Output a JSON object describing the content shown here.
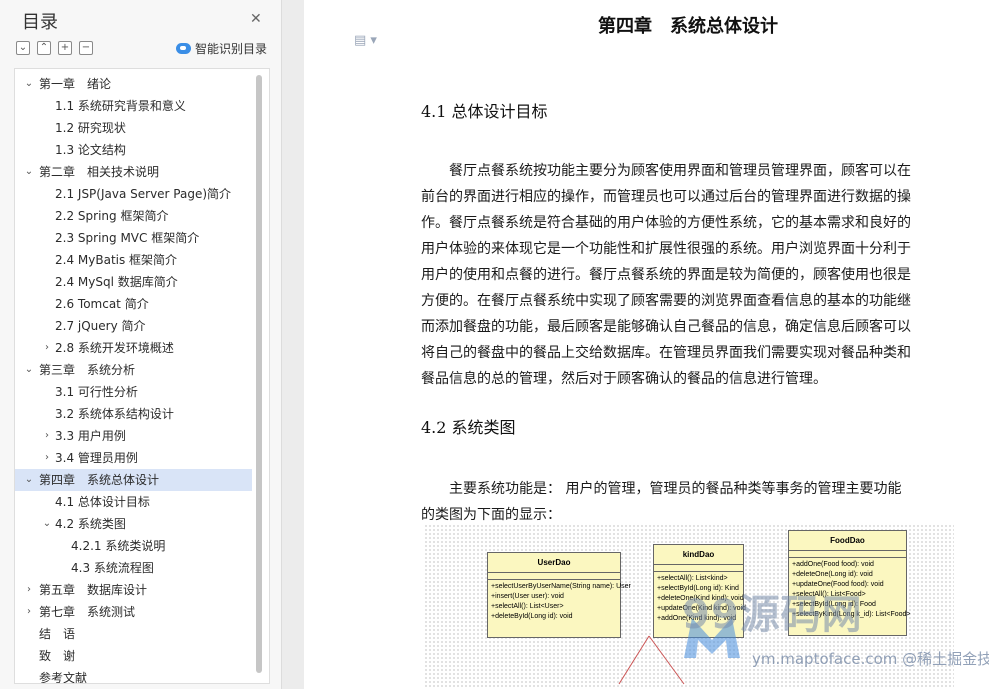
{
  "sidebar": {
    "title": "目录",
    "smart_label": "智能识别目录",
    "toc": [
      {
        "label": "第一章　绪论",
        "arrow": "down",
        "active": false
      },
      {
        "label": "1.1 系统研究背景和意义",
        "arrow": "",
        "active": false
      },
      {
        "label": "1.2 研究现状",
        "arrow": "",
        "active": false
      },
      {
        "label": "1.3 论文结构",
        "arrow": "",
        "active": false
      },
      {
        "label": "第二章　相关技术说明",
        "arrow": "down",
        "active": false
      },
      {
        "label": "2.1 JSP(Java Server Page)简介",
        "arrow": "",
        "active": false
      },
      {
        "label": "2.2 Spring 框架简介",
        "arrow": "",
        "active": false
      },
      {
        "label": "2.3 Spring MVC 框架简介",
        "arrow": "",
        "active": false
      },
      {
        "label": "2.4 MyBatis 框架简介",
        "arrow": "",
        "active": false
      },
      {
        "label": "2.4 MySql 数据库简介",
        "arrow": "",
        "active": false
      },
      {
        "label": "2.6 Tomcat 简介",
        "arrow": "",
        "active": false
      },
      {
        "label": "2.7 jQuery 简介",
        "arrow": "",
        "active": false
      },
      {
        "label": "2.8 系统开发环境概述",
        "arrow": "right",
        "active": false
      },
      {
        "label": "第三章　系统分析",
        "arrow": "down",
        "active": false
      },
      {
        "label": "3.1 可行性分析",
        "arrow": "",
        "active": false
      },
      {
        "label": "3.2 系统体系结构设计",
        "arrow": "",
        "active": false
      },
      {
        "label": "3.3 用户用例",
        "arrow": "right",
        "active": false
      },
      {
        "label": "3.4 管理员用例",
        "arrow": "right",
        "active": false
      },
      {
        "label": "第四章　系统总体设计",
        "arrow": "down",
        "active": true
      },
      {
        "label": "4.1 总体设计目标",
        "arrow": "",
        "active": false
      },
      {
        "label": "4.2 系统类图",
        "arrow": "down",
        "active": false
      },
      {
        "label": "4.2.1 系统类说明",
        "arrow": "",
        "active": false
      },
      {
        "label": "4.3 系统流程图",
        "arrow": "",
        "active": false
      },
      {
        "label": "第五章　数据库设计",
        "arrow": "right",
        "active": false
      },
      {
        "label": "第七章　系统测试",
        "arrow": "right",
        "active": false
      },
      {
        "label": "结　语",
        "arrow": "",
        "active": false
      },
      {
        "label": "致　谢",
        "arrow": "",
        "active": false
      },
      {
        "label": "参考文献",
        "arrow": "",
        "active": false
      }
    ]
  },
  "document": {
    "chapter_title": "第四章　系统总体设计",
    "section1_title": "4.1 总体设计目标",
    "section1_lines": [
      "　　餐厅点餐系统按功能主要分为顾客使用界面和管理员管理界面，顾客可以在",
      "前台的界面进行相应的操作，而管理员也可以通过后台的管理界面进行数据的操",
      "作。餐厅点餐系统是符合基础的用户体验的方便性系统，它的基本需求和良好的",
      "用户体验的来体现它是一个功能性和扩展性很强的系统。用户浏览界面十分利于",
      "用户的使用和点餐的进行。餐厅点餐系统的界面是较为简便的，顾客使用也很是",
      "方便的。在餐厅点餐系统中实现了顾客需要的浏览界面查看信息的基本的功能继",
      "而添加餐盘的功能，最后顾客是能够确认自己餐品的信息，确定信息后顾客可以",
      "将自己的餐盘中的餐品上交给数据库。在管理员界面我们需要实现对餐品种类和",
      "餐品信息的总的管理，然后对于顾客确认的餐品的信息进行管理。"
    ],
    "section2_title": "4.2 系统类图",
    "section2_lines": [
      "　　主要系统功能是：  用户的管理，管理员的餐品种类等事务的管理主要功能",
      "的类图为下面的显示："
    ]
  },
  "uml": {
    "classes": [
      {
        "name": "UserDao",
        "ops": [
          "+selectUserByUserName(String name): User",
          "+insert(User user): void",
          "+selectAll(): List<User>",
          "+deleteById(Long id): void"
        ]
      },
      {
        "name": "kindDao",
        "ops": [
          "+selectAll(): List<kind>",
          "+selectById(Long id): Kind",
          "+deleteOne(Kind kind): void",
          "+updateOne(Kind kind): void",
          "+addOne(Kind kind): void"
        ]
      },
      {
        "name": "FoodDao",
        "ops": [
          "+addOne(Food food): void",
          "+deleteOne(Long id): void",
          "+updateOne(Food food): void",
          "+selectAll(): List<Food>",
          "+selectById(Long id): Food",
          "+selectByKind(Long k_id): List<Food>"
        ]
      }
    ]
  },
  "watermark": {
    "brand": "99源码网",
    "sub": "ym.maptoface.com @稀土掘金技术社区"
  }
}
